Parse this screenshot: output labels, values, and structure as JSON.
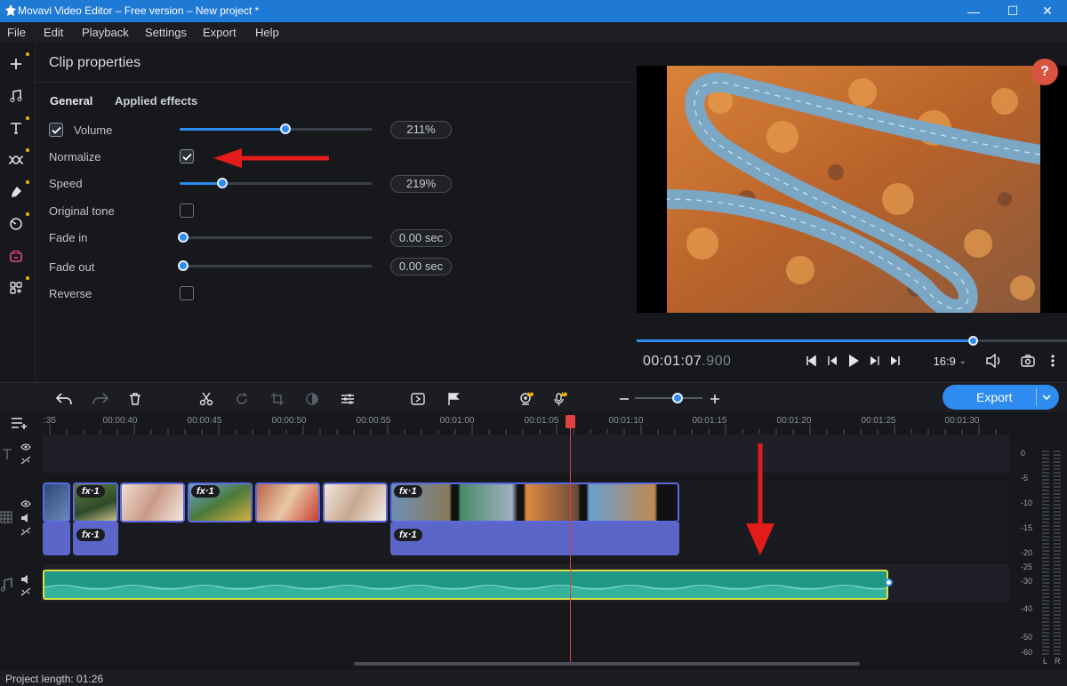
{
  "window": {
    "title": "Movavi Video Editor – Free version – New project *"
  },
  "menu": [
    "File",
    "Edit",
    "Playback",
    "Settings",
    "Export",
    "Help"
  ],
  "left_tools": [
    "plus-icon",
    "music-note-icon",
    "text-icon",
    "transition-icon",
    "sticker-icon",
    "filter-icon",
    "clip-effects-icon",
    "more-tools-icon"
  ],
  "properties": {
    "title": "Clip properties",
    "tabs": [
      "General",
      "Applied effects"
    ],
    "volume": {
      "label": "Volume",
      "value": "211%",
      "level": 0.55,
      "checked": true
    },
    "normalize": {
      "label": "Normalize",
      "checked": true
    },
    "speed": {
      "label": "Speed",
      "value": "219%",
      "level": 0.22
    },
    "original_tone": {
      "label": "Original tone",
      "checked": false
    },
    "fade_in": {
      "label": "Fade in",
      "value": "0.00 sec",
      "level": 0.02
    },
    "fade_out": {
      "label": "Fade out",
      "value": "0.00 sec",
      "level": 0.02
    },
    "reverse": {
      "label": "Reverse",
      "checked": false
    }
  },
  "preview": {
    "help": "?",
    "timecode_main": "00:01:07",
    "timecode_ms": ".900",
    "aspect": "16:9",
    "progress": 0.78
  },
  "timeline": {
    "export_label": "Export",
    "ruler": [
      ":35",
      "00:00:40",
      "00:00:45",
      "00:00:50",
      "00:00:55",
      "00:01:00",
      "00:01:05",
      "00:01:10",
      "00:01:15",
      "00:01:20",
      "00:01:25",
      "00:01:30"
    ],
    "fx_label": "fx·1",
    "meter_labels": [
      "0",
      "-5",
      "-10",
      "-15",
      "-20",
      "-25",
      "-30",
      "-40",
      "-50",
      "-60"
    ],
    "meter_channels": [
      "L",
      "R"
    ]
  },
  "status": {
    "text": "Project length: 01:26"
  },
  "colors": {
    "accent": "#2e8bf0",
    "titlebar": "#1f7ad6",
    "audio": "#1f9985",
    "annotation": "#e21b1b"
  }
}
